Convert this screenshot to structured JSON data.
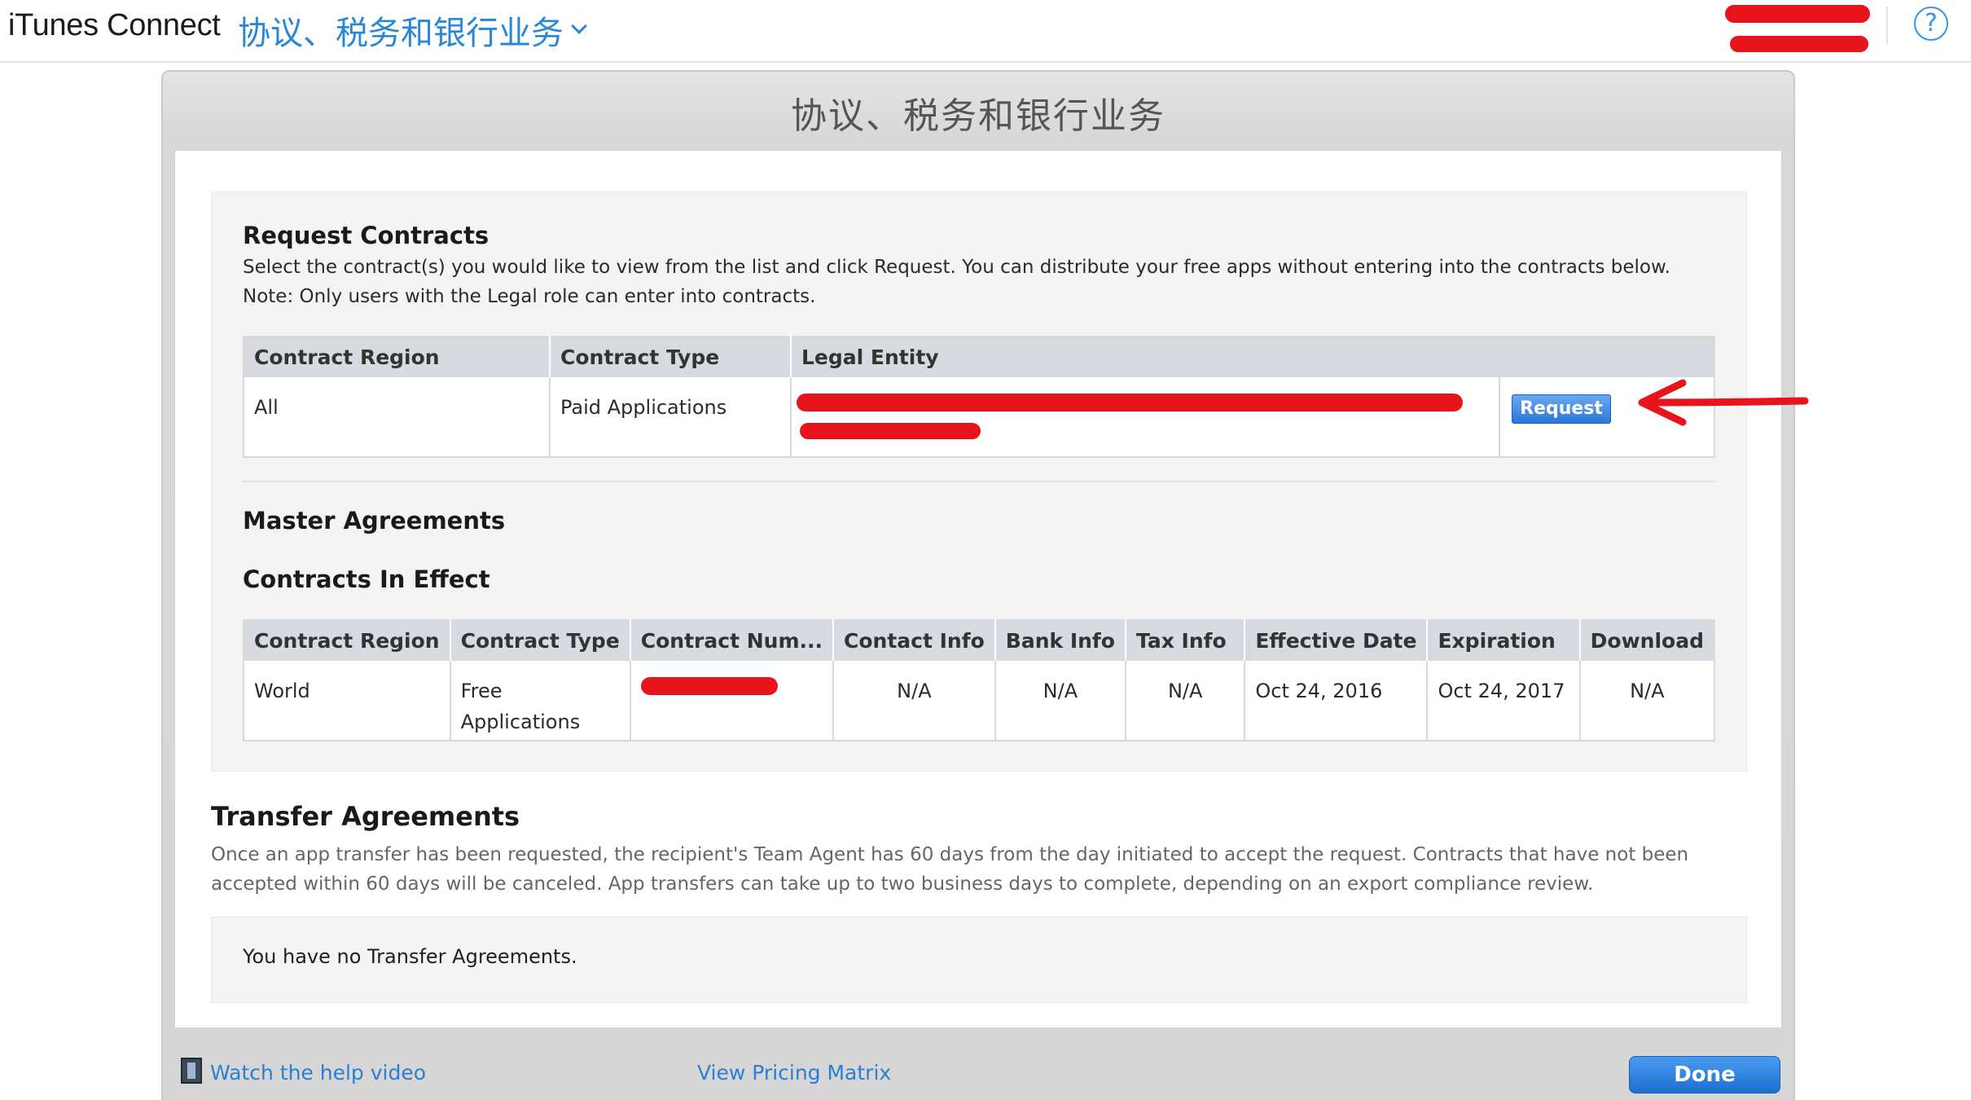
{
  "topbar": {
    "app_title": "iTunes Connect",
    "section_menu": "协议、税务和银行业务",
    "help": "?"
  },
  "modal": {
    "title": "协议、税务和银行业务",
    "request_contracts": {
      "heading": "Request Contracts",
      "desc_line1": "Select the contract(s) you would like to view from the list and click Request. You can distribute your free apps without entering into the contracts below.",
      "desc_line2": "Note: Only users with the Legal role can enter into contracts.",
      "columns": [
        "Contract Region",
        "Contract Type",
        "Legal Entity"
      ],
      "row": {
        "region": "All",
        "type": "Paid Applications",
        "button": "Request"
      }
    },
    "master_agreements": {
      "heading": "Master Agreements"
    },
    "contracts_in_effect": {
      "heading": "Contracts In Effect",
      "columns": [
        "Contract Region",
        "Contract Type",
        "Contract Num...",
        "Contact Info",
        "Bank Info",
        "Tax Info",
        "Effective Date",
        "Expiration",
        "Download"
      ],
      "row": {
        "region": "World",
        "type_line1": "Free",
        "type_line2": "Applications",
        "contact": "N/A",
        "bank": "N/A",
        "tax": "N/A",
        "effective": "Oct 24, 2016",
        "expiration": "Oct 24, 2017",
        "download": "N/A"
      }
    },
    "transfer": {
      "heading": "Transfer Agreements",
      "desc_line1": "Once an app transfer has been requested, the recipient's Team Agent has 60 days from the day initiated to accept the request. Contracts that have not been",
      "desc_line2": "accepted within 60 days will be canceled. App transfers can take up to two business days to complete, depending on an export compliance review.",
      "empty": "You have no Transfer Agreements."
    },
    "footer": {
      "help_video": "Watch the help video",
      "pricing": "View Pricing Matrix",
      "done": "Done"
    }
  },
  "colors": {
    "accent": "#2a87d8",
    "redaction": "#e8141b",
    "header_bg": "#d6dbe1"
  }
}
